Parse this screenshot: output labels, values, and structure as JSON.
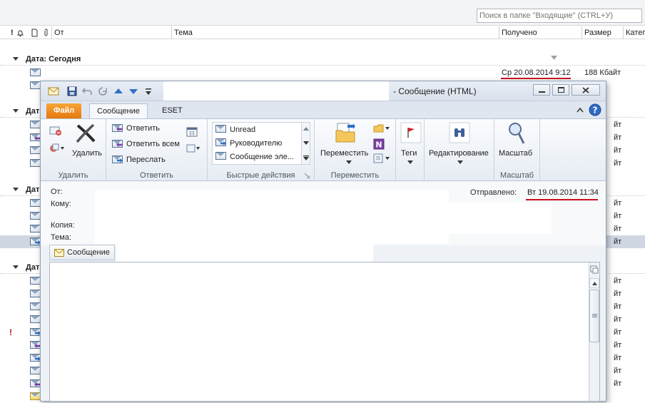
{
  "inbox": {
    "search_placeholder": "Поиск в папке \"Входящие\" (CTRL+У)",
    "columns": {
      "importance": "!",
      "from": "От",
      "subject": "Тема",
      "received": "Получено",
      "size": "Размер",
      "categories": "Катег"
    },
    "group_today": "Дата: Сегодня",
    "group_partial": "Дат",
    "first_row_received": "Ср 20.08.2014 9:12",
    "first_row_size": "188 Кбайт",
    "size_partial": "йт"
  },
  "message": {
    "title": "-  Сообщение (HTML)",
    "tabs": {
      "file": "Файл",
      "message": "Сообщение",
      "eset": "ESET"
    },
    "ribbon": {
      "delete_group": "Удалить",
      "delete_button": "Удалить",
      "respond_group": "Ответить",
      "reply": "Ответить",
      "reply_all": "Ответить всем",
      "forward": "Переслать",
      "quick_steps_group": "Быстрые действия",
      "quick_steps": [
        "Unread",
        "Руководителю",
        "Сообщение эле..."
      ],
      "move_group": "Переместить",
      "move_button": "Переместить",
      "tags_button": "Теги",
      "editing_button": "Редактирование",
      "zoom_group": "Масштаб",
      "zoom_button": "Масштаб"
    },
    "header_labels": {
      "from": "От:",
      "to": "Кому:",
      "cc": "Копия:",
      "subject": "Тема:",
      "sent_label": "Отправлено:"
    },
    "sent_value": "Вт 19.08.2014 11:34",
    "body_tab": "Сообщение"
  }
}
